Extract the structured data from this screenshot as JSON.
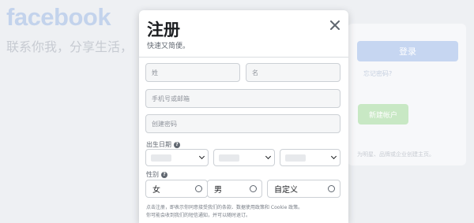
{
  "background": {
    "logo": "facebook",
    "tagline": "联系你我，分享生活，",
    "login_button": "登录",
    "forgot_link": "忘记密码?",
    "create_button": "新建帐户",
    "footnote": "为明星、品牌或企业创建主页。"
  },
  "modal": {
    "title": "注册",
    "subtitle": "快速又简便。",
    "close_icon": "close-icon",
    "fields": {
      "last_name_placeholder": "姓",
      "first_name_placeholder": "名",
      "phone_email_placeholder": "手机号或邮箱",
      "password_placeholder": "创建密码"
    },
    "dob": {
      "label": "出生日期",
      "help_glyph": "?"
    },
    "gender": {
      "label": "性别",
      "help_glyph": "?",
      "options": [
        "女",
        "男",
        "自定义"
      ]
    },
    "terms_line1": "点击注册，即表示你同意接受我们的条款、数据使用政策和 Cookie 政策。",
    "terms_line2": "你可能会收到我们的短信通知，并可以随时退订。"
  },
  "colors": {
    "brand": "#1877f2",
    "create_green": "#42b72a",
    "text": "#1c1e21",
    "muted": "#606770"
  }
}
